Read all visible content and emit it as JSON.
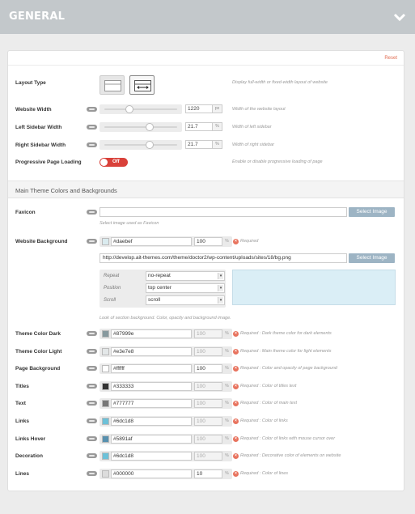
{
  "header": {
    "title": "GENERAL"
  },
  "panel": {
    "reset_label": "Reset"
  },
  "layout": {
    "label": "Layout Type",
    "description": "Display full-width or fixed-width layout of website"
  },
  "website_width": {
    "label": "Website Width",
    "value": "1220",
    "unit": "px",
    "slider_fraction": 0.34,
    "description": "Width of the website layout"
  },
  "left_sidebar": {
    "label": "Left Sidebar Width",
    "value": "21.7",
    "unit": "%",
    "slider_fraction": 0.62,
    "description": "Width of left sidebar"
  },
  "right_sidebar": {
    "label": "Right Sidebar Width",
    "value": "21.7",
    "unit": "%",
    "slider_fraction": 0.62,
    "description": "Width of right sidebar"
  },
  "progressive": {
    "label": "Progressive Page Loading",
    "state": "Off",
    "description": "Enable or disable progressive loading of page"
  },
  "section": {
    "title": "Main Theme Colors and Backgrounds"
  },
  "favicon": {
    "label": "Favicon",
    "value": "",
    "button": "Select Image",
    "help": "Select image used as Favicon"
  },
  "website_bg": {
    "label": "Website Background",
    "color": "#daebef",
    "opacity": "100",
    "unit": "%",
    "required": "Required",
    "image_url": "http://develop.ait-themes.com/theme/doctor2/wp-content/uploads/sites/18/bg.png",
    "button": "Select Image",
    "repeat_label": "Repeat",
    "repeat_value": "no-repeat",
    "position_label": "Position",
    "position_value": "top center",
    "scroll_label": "Scroll",
    "scroll_value": "scroll",
    "help": "Look of section background. Color, opacity and background image."
  },
  "colors": [
    {
      "label": "Theme Color Dark",
      "swatch": "#87999e",
      "value": "#87999e",
      "opacity": "100",
      "disabled": true,
      "required": "Required : Dark theme color for dark elements"
    },
    {
      "label": "Theme Color Light",
      "swatch": "#e3e7e8",
      "value": "#e3e7e8",
      "opacity": "100",
      "disabled": true,
      "required": "Required : Main theme color for light elements"
    },
    {
      "label": "Page Background",
      "swatch": "#ffffff",
      "value": "#ffffff",
      "opacity": "100",
      "disabled": false,
      "required": "Required : Color and opacity of page background"
    },
    {
      "label": "Titles",
      "swatch": "#333333",
      "value": "#333333",
      "opacity": "100",
      "disabled": true,
      "required": "Required : Color of titles text"
    },
    {
      "label": "Text",
      "swatch": "#777777",
      "value": "#777777",
      "opacity": "100",
      "disabled": true,
      "required": "Required : Color of main text"
    },
    {
      "label": "Links",
      "swatch": "#6dc1d8",
      "value": "#6dc1d8",
      "opacity": "100",
      "disabled": true,
      "required": "Required : Color of links"
    },
    {
      "label": "Links Hover",
      "swatch": "#5891af",
      "value": "#5891af",
      "opacity": "100",
      "disabled": true,
      "required": "Required : Color of links with mouse cursor over"
    },
    {
      "label": "Decoration",
      "swatch": "#6dc1d8",
      "value": "#6dc1d8",
      "opacity": "100",
      "disabled": true,
      "required": "Required : Decorative color of elements on website"
    },
    {
      "label": "Lines",
      "swatch": "#dcdcdc",
      "value": "#000000",
      "opacity": "10",
      "disabled": false,
      "required": "Required : Color of lines"
    }
  ],
  "unit_pct": "%"
}
